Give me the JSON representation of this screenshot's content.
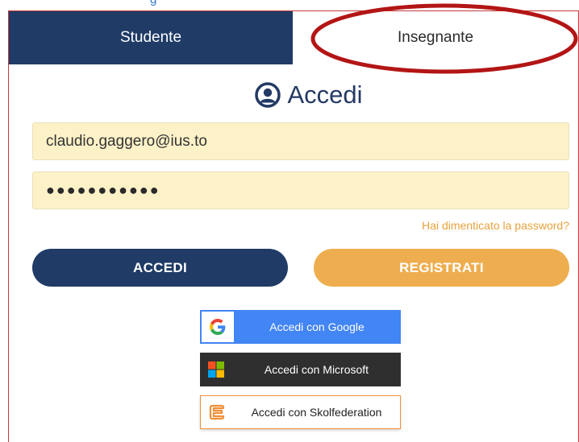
{
  "tabs": {
    "student_label": "Studente",
    "teacher_label": "Insegnante"
  },
  "title": {
    "text": "Accedi",
    "icon": "user-circle-icon"
  },
  "form": {
    "email_value": "claudio.gaggero@ius.to",
    "password_value": "●●●●●●●●●●●",
    "forgot_password_link": "Hai dimenticato la password?"
  },
  "buttons": {
    "login_label": "ACCEDI",
    "register_label": "REGISTRATI"
  },
  "sso": {
    "google_label": "Accedi con Google",
    "microsoft_label": "Accedi con Microsoft",
    "skolfederation_label": "Accedi con Skolfederation"
  },
  "colors": {
    "navy": "#1f3b66",
    "orange": "#eeae4f",
    "field_bg": "#fdf1c8",
    "highlight_ring": "#b31515",
    "google_blue": "#4285f4"
  }
}
